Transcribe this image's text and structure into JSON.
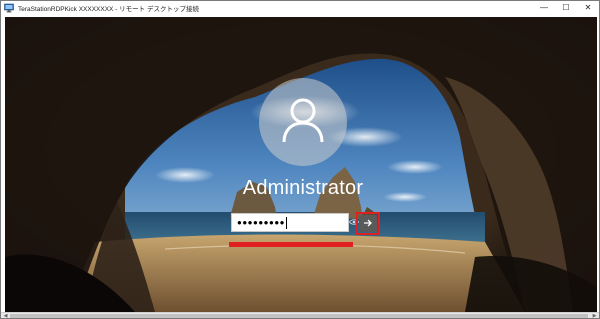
{
  "window": {
    "title": "TeraStationRDPKick XXXXXXXX - リモート デスクトップ接続",
    "controls": {
      "minimize": "—",
      "maximize": "☐",
      "close": "✕"
    }
  },
  "lockscreen": {
    "username": "Administrator",
    "password_mask": "●●●●●●●●●"
  },
  "icons": {
    "app": "remote-desktop-icon",
    "avatar": "user-silhouette-icon",
    "reveal": "eye-icon",
    "submit": "arrow-right-icon"
  },
  "colors": {
    "annotation": "#e02020",
    "sky": "#4f82b8",
    "sea": "#2d5a7a",
    "sand": "#b08a56",
    "cave": "#1a1410"
  }
}
